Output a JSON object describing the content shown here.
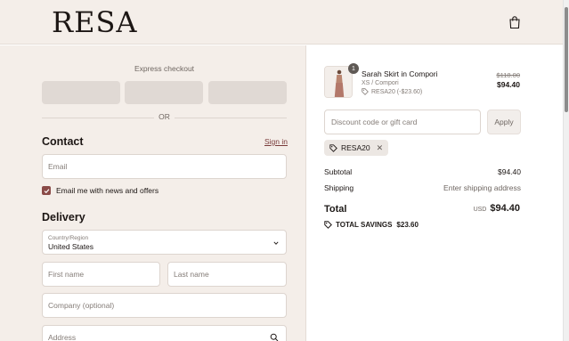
{
  "header": {
    "logo": "RESA",
    "cart_icon": "shopping-bag-icon"
  },
  "express": {
    "title": "Express checkout",
    "or": "OR"
  },
  "contact": {
    "title": "Contact",
    "signin": "Sign in",
    "email_placeholder": "Email",
    "newsletter_label": "Email me with news and offers",
    "newsletter_checked": true
  },
  "delivery": {
    "title": "Delivery",
    "country_label": "Country/Region",
    "country_value": "United States",
    "first_name": "First name",
    "last_name": "Last name",
    "company": "Company (optional)",
    "address": "Address"
  },
  "order": {
    "quantity": "1",
    "product_name": "Sarah Skirt in Compori",
    "variant": "XS / Compori",
    "discount_line": "RESA20 (-$23.60)",
    "price_original": "$118.00",
    "price_current": "$94.40",
    "discount_placeholder": "Discount code or gift card",
    "apply": "Apply",
    "applied_code": "RESA20",
    "subtotal_label": "Subtotal",
    "subtotal_value": "$94.40",
    "shipping_label": "Shipping",
    "shipping_value": "Enter shipping address",
    "total_label": "Total",
    "currency": "USD",
    "total_value": "$94.40",
    "savings_label": "TOTAL SAVINGS",
    "savings_value": "$23.60"
  },
  "colors": {
    "accent": "#8a4a47",
    "panel": "#f4eee9",
    "button": "#e0d9d4"
  }
}
